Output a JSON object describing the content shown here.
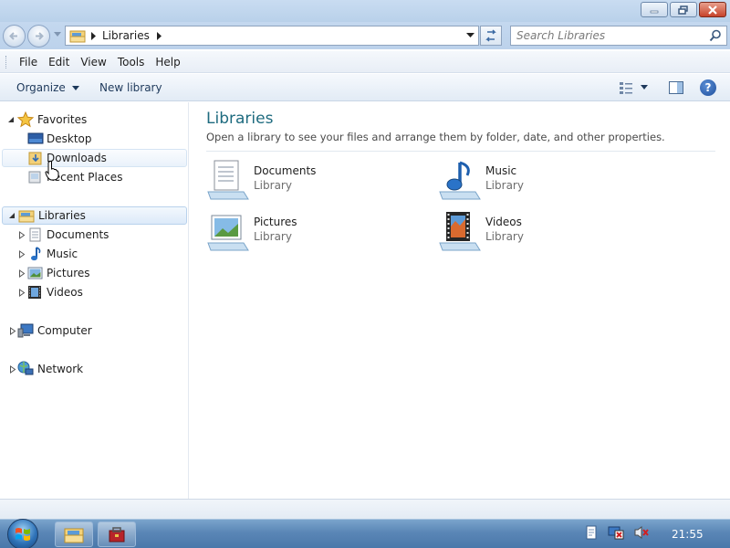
{
  "address": {
    "path_label": "Libraries"
  },
  "search": {
    "placeholder": "Search Libraries"
  },
  "menu": {
    "file": "File",
    "edit": "Edit",
    "view": "View",
    "tools": "Tools",
    "help": "Help"
  },
  "commands": {
    "organize": "Organize",
    "new_library": "New library"
  },
  "nav": {
    "favorites": "Favorites",
    "desktop": "Desktop",
    "downloads": "Downloads",
    "recent_places": "Recent Places",
    "libraries": "Libraries",
    "documents": "Documents",
    "music": "Music",
    "pictures": "Pictures",
    "videos": "Videos",
    "computer": "Computer",
    "network": "Network"
  },
  "content": {
    "title": "Libraries",
    "subtitle": "Open a library to see your files and arrange them by folder, date, and other properties.",
    "libraries": [
      {
        "name": "Documents",
        "type": "Library",
        "icon": "documents-library-icon"
      },
      {
        "name": "Music",
        "type": "Library",
        "icon": "music-library-icon"
      },
      {
        "name": "Pictures",
        "type": "Library",
        "icon": "pictures-library-icon"
      },
      {
        "name": "Videos",
        "type": "Library",
        "icon": "videos-library-icon"
      }
    ]
  },
  "taskbar": {
    "clock": "21:55"
  },
  "colors": {
    "title_accent": "#1e6b7f",
    "selection": "#dceaf9",
    "taskbar": "#5a86b6"
  }
}
